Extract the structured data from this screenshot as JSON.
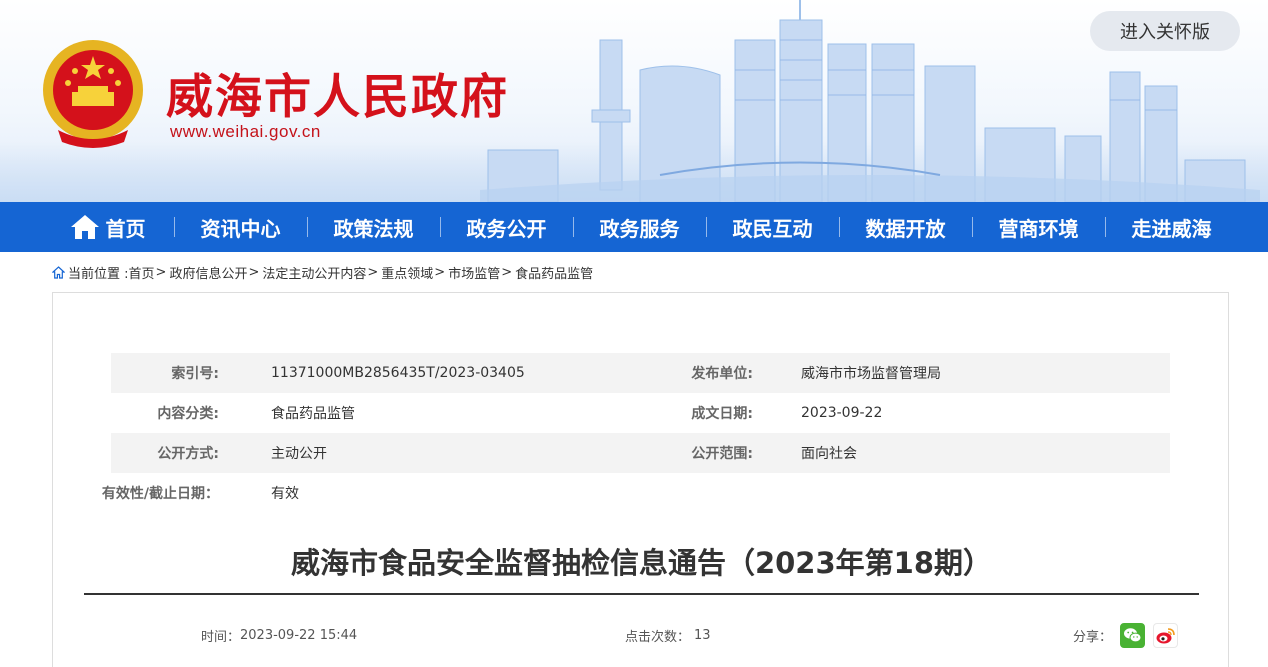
{
  "header": {
    "site_title": "威海市人民政府",
    "site_url": "www.weihai.gov.cn",
    "care_mode_button": "进入关怀版",
    "colors": {
      "brand_red": "#d4111b",
      "nav_blue": "#1565d3"
    }
  },
  "nav": {
    "items": [
      {
        "label": "首页",
        "icon": "home-icon"
      },
      {
        "label": "资讯中心"
      },
      {
        "label": "政策法规"
      },
      {
        "label": "政务公开"
      },
      {
        "label": "政务服务"
      },
      {
        "label": "政民互动"
      },
      {
        "label": "数据开放"
      },
      {
        "label": "营商环境"
      },
      {
        "label": "走进威海"
      }
    ]
  },
  "breadcrumb": {
    "prefix": "当前位置 :",
    "items": [
      "首页",
      "政府信息公开",
      "法定主动公开内容",
      "重点领域",
      "市场监管",
      "食品药品监管"
    ],
    "separator": ">"
  },
  "meta": {
    "index_label": "索引号:",
    "index_value": "11371000MB2856435T/2023-03405",
    "publisher_label": "发布单位:",
    "publisher_value": "威海市市场监督管理局",
    "category_label": "内容分类:",
    "category_value": "食品药品监管",
    "date_label": "成文日期:",
    "date_value": "2023-09-22",
    "method_label": "公开方式:",
    "method_value": "主动公开",
    "scope_label": "公开范围:",
    "scope_value": "面向社会",
    "validity_label": "有效性/截止日期：",
    "validity_value": "有效"
  },
  "article": {
    "title": "威海市食品安全监督抽检信息通告（2023年第18期）",
    "time_label": "时间：",
    "time_value": "2023-09-22 15:44",
    "views_label": "点击次数：",
    "views_value": "13",
    "share_label": "分享："
  },
  "share": [
    {
      "icon": "wechat-icon",
      "color": "#49b233"
    },
    {
      "icon": "weibo-icon",
      "color": "#e6162d"
    }
  ]
}
